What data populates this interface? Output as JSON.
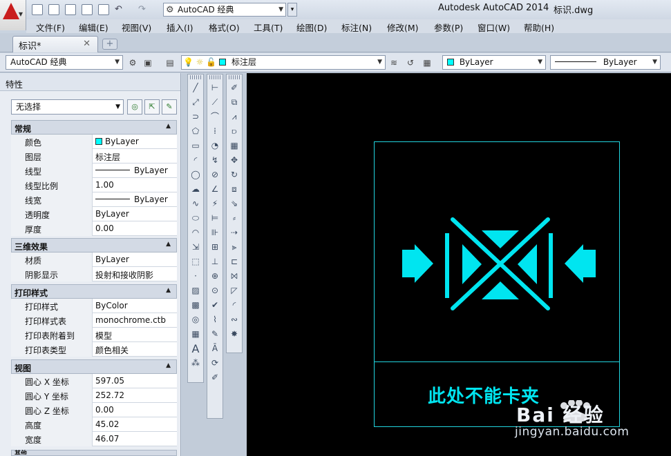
{
  "titlebar": {
    "workspace": "AutoCAD 经典",
    "app_title": "Autodesk AutoCAD 2014",
    "file_title": "标识.dwg"
  },
  "menu": [
    "文件(F)",
    "编辑(E)",
    "视图(V)",
    "插入(I)",
    "格式(O)",
    "工具(T)",
    "绘图(D)",
    "标注(N)",
    "修改(M)",
    "参数(P)",
    "窗口(W)",
    "帮助(H)"
  ],
  "tabs": {
    "active": "标识*"
  },
  "toolbar2": {
    "workspace": "AutoCAD 经典",
    "layer": "标注层",
    "color": "ByLayer",
    "linetype": "ByLayer"
  },
  "properties": {
    "title": "特性",
    "selection": "无选择",
    "categories": [
      {
        "name": "常规",
        "rows": [
          {
            "key": "颜色",
            "value": "ByLayer"
          },
          {
            "key": "图层",
            "value": "标注层"
          },
          {
            "key": "线型",
            "value": "ByLayer"
          },
          {
            "key": "线型比例",
            "value": "1.00"
          },
          {
            "key": "线宽",
            "value": "ByLayer"
          },
          {
            "key": "透明度",
            "value": "ByLayer"
          },
          {
            "key": "厚度",
            "value": "0.00"
          }
        ]
      },
      {
        "name": "三维效果",
        "rows": [
          {
            "key": "材质",
            "value": "ByLayer"
          },
          {
            "key": "阴影显示",
            "value": "投射和接收阴影"
          }
        ]
      },
      {
        "name": "打印样式",
        "rows": [
          {
            "key": "打印样式",
            "value": "ByColor"
          },
          {
            "key": "打印样式表",
            "value": "monochrome.ctb"
          },
          {
            "key": "打印表附着到",
            "value": "模型"
          },
          {
            "key": "打印表类型",
            "value": "颜色相关"
          }
        ]
      },
      {
        "name": "视图",
        "rows": [
          {
            "key": "圆心 X 坐标",
            "value": "597.05"
          },
          {
            "key": "圆心 Y 坐标",
            "value": "252.72"
          },
          {
            "key": "圆心 Z 坐标",
            "value": "0.00"
          },
          {
            "key": "高度",
            "value": "45.02"
          },
          {
            "key": "宽度",
            "value": "46.07"
          }
        ]
      },
      {
        "name": "其他",
        "rows": []
      }
    ]
  },
  "canvas": {
    "note": "此处不能卡夹",
    "drawing_color": "#00ffff"
  },
  "watermark": {
    "logo": "Bai 经验",
    "url": "jingyan.baidu.com"
  },
  "colors": {
    "canvas_bg": "#000000",
    "cyan": "#00e5f0",
    "logo_red": "#c91d1d"
  }
}
